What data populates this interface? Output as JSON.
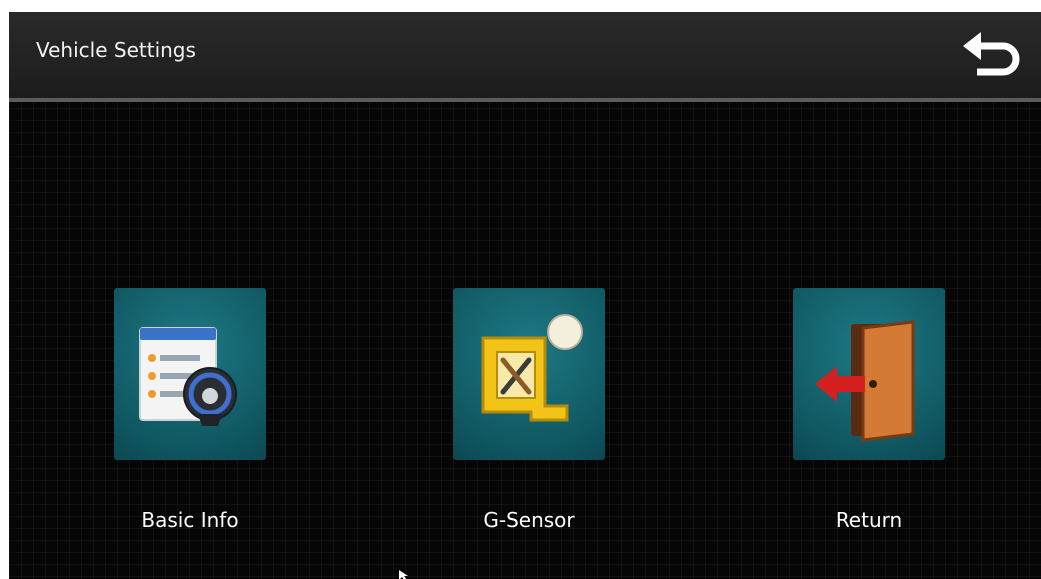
{
  "header": {
    "title": "Vehicle Settings",
    "back_icon": "back-arrow-icon"
  },
  "tiles": [
    {
      "label": "Basic Info",
      "icon": "vehicle-info-icon"
    },
    {
      "label": "G-Sensor",
      "icon": "g-sensor-tools-icon"
    },
    {
      "label": "Return",
      "icon": "exit-door-icon"
    }
  ],
  "colors": {
    "tile_bg": "#0f5660",
    "header_bg": "#1c1c1c",
    "screen_bg": "#060606",
    "accent_yellow": "#f2c418",
    "arrow_red": "#d42020"
  }
}
